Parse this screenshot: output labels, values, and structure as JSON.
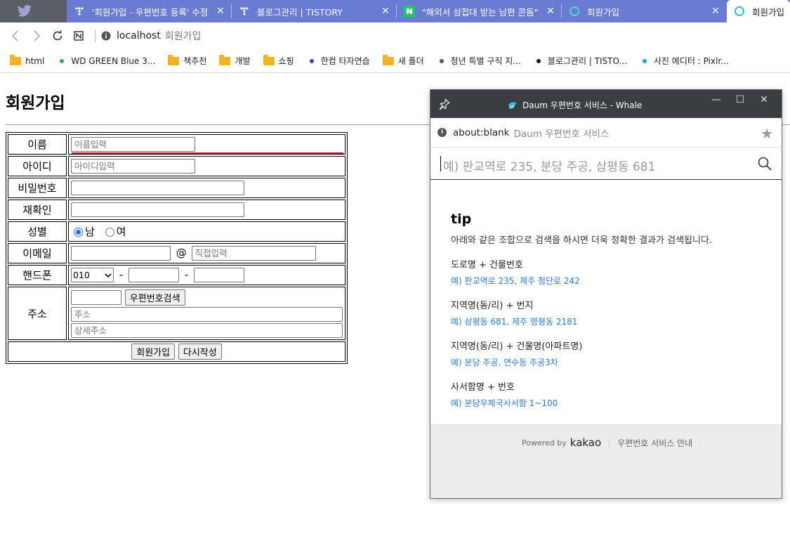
{
  "browser": {
    "tabs": [
      {
        "title": "'회원가입 - 우편번호 등록' 수정",
        "favicon": "tistory-icon"
      },
      {
        "title": "블로그관리 | TISTORY",
        "favicon": "tistory-icon"
      },
      {
        "title": "\"해외서 성접대 받는 남편 콘돔\"",
        "favicon": "naver-icon"
      },
      {
        "title": "회원가입",
        "favicon": "whale-ring-icon"
      },
      {
        "title": "회원가입",
        "favicon": "whale-ring-icon"
      }
    ],
    "address": {
      "host": "localhost",
      "title": "회원가입"
    },
    "bookmarks": [
      {
        "label": "html",
        "kind": "folder"
      },
      {
        "label": "WD GREEN Blue 3...",
        "kind": "dot",
        "color": "#2bb24c"
      },
      {
        "label": "책추천",
        "kind": "folder"
      },
      {
        "label": "개발",
        "kind": "folder"
      },
      {
        "label": "쇼핑",
        "kind": "folder"
      },
      {
        "label": "한컴 타자연습",
        "kind": "dot",
        "color": "#5b3aa8"
      },
      {
        "label": "새 폴더",
        "kind": "folder"
      },
      {
        "label": "청년 특별 구직 지...",
        "kind": "dot",
        "color": "#555555"
      },
      {
        "label": "블로그관리 | TISTO...",
        "kind": "dot",
        "color": "#111111"
      },
      {
        "label": "사진 에디터 : Pixlr...",
        "kind": "dot",
        "color": "#1ba4d4"
      }
    ]
  },
  "form": {
    "title": "회원가입",
    "labels": {
      "name": "이름",
      "id": "아이디",
      "password": "비밀번호",
      "confirm": "재확인",
      "gender": "성별",
      "email": "이메일",
      "phone": "핸드폰",
      "address": "주소"
    },
    "placeholders": {
      "name": "이름입력",
      "id": "아이디입력",
      "email_domain": "직접입력",
      "address": "주소",
      "address_detail": "상세주소"
    },
    "gender": {
      "male": "남",
      "female": "여",
      "selected": "male"
    },
    "email_at": "@",
    "phone": {
      "prefix": "010",
      "dash": "-"
    },
    "zip_button": "우편번호검색",
    "submit": "회원가입",
    "reset": "다시작성"
  },
  "popup": {
    "window_title": "Daum 우편번호 서비스 - Whale",
    "address_blank": "about:blank",
    "address_title": "Daum 우편번호 서비스",
    "search_placeholder": "예) 판교역로 235, 분당 주공, 삼평동 681",
    "tip_title": "tip",
    "tip_desc": "아래와 같은 조합으로 검색을 하시면 더욱 정확한 결과가 검색됩니다.",
    "tips": [
      {
        "label": "도로명 + 건물번호",
        "example": "예) 판교역로 235,  제주 첨단로 242"
      },
      {
        "label": "지역명(동/리) + 번지",
        "example": "예) 삼평동 681,  제주 영평동 2181"
      },
      {
        "label": "지역명(동/리) + 건물명(아파트명)",
        "example": "예) 분당 주공,  연수동 주공3차"
      },
      {
        "label": "사서함명 + 번호",
        "example": "예) 분당우체국사서함 1~100"
      }
    ],
    "powered_by": "Powered by",
    "kakao": "kakao",
    "guide": "우편번호 서비스 안내"
  }
}
